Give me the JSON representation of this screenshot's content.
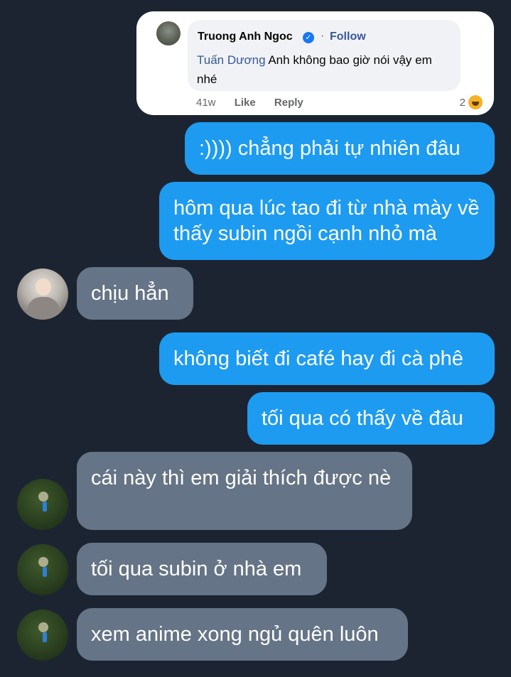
{
  "embed": {
    "name": "Truong Anh Ngoc",
    "verified_glyph": "✓",
    "dot": "·",
    "follow": "Follow",
    "mention": "Tuấn Dương",
    "text": " Anh không bao giờ nói vậy em nhé",
    "age": "41w",
    "like": "Like",
    "reply": "Reply",
    "reaction_count": "2",
    "reaction_icon": "haha-icon"
  },
  "messages": [
    {
      "side": "me",
      "text": ":)))) chẳng phải tự nhiên đâu"
    },
    {
      "side": "me",
      "text": "hôm qua lúc tao đi từ nhà mày về thấy subin ngồi cạnh nhỏ mà"
    },
    {
      "side": "them",
      "avatar": "girl",
      "text": "chịu hẳn"
    },
    {
      "side": "me",
      "text": "không biết đi café hay đi cà phê"
    },
    {
      "side": "me",
      "text": "tối qua có thấy về đâu"
    },
    {
      "side": "them",
      "avatar": "green",
      "text": "cái này thì em giải thích được nè"
    },
    {
      "side": "them",
      "avatar": "green",
      "text": "tối qua subin ở nhà em"
    },
    {
      "side": "them",
      "avatar": "green",
      "text": "xem anime xong ngủ quên luôn"
    }
  ],
  "colors": {
    "background": "#1c2431",
    "outgoing": "#1d9bf0",
    "incoming": "#657486",
    "link": "#385898"
  }
}
